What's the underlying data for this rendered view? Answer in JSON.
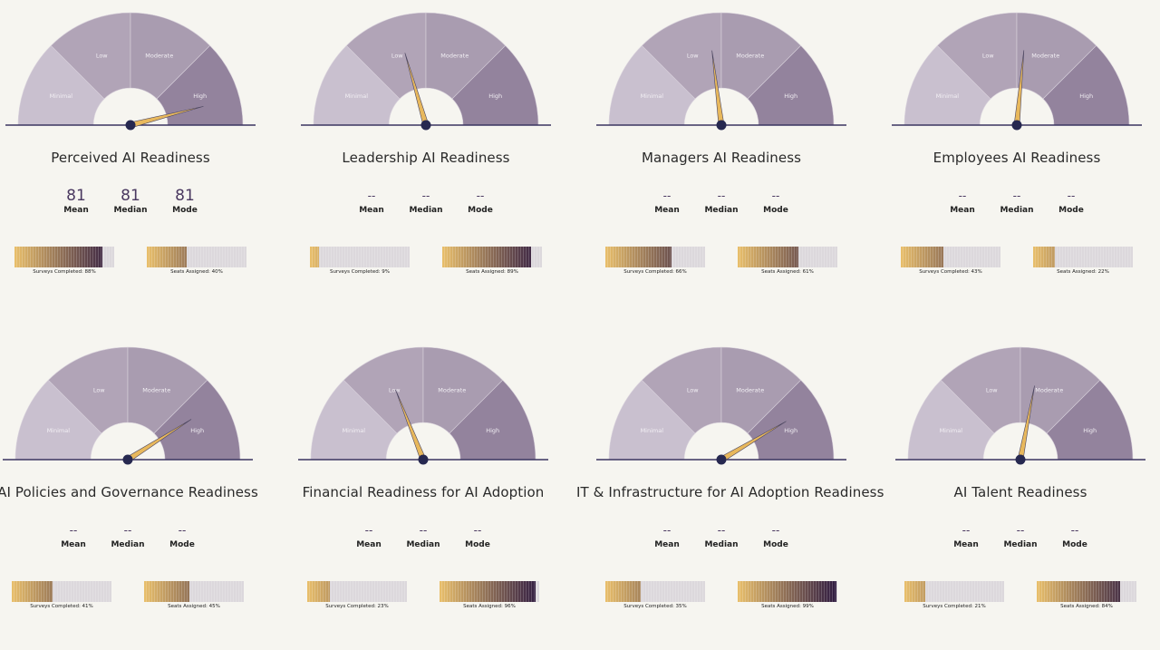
{
  "gauge_segments": [
    "Minimal",
    "Low",
    "Moderate",
    "High"
  ],
  "colors": {
    "background": "#f6f5f0",
    "segment_minimal": "#c9c0cf",
    "segment_low": "#b1a4b7",
    "segment_moderate": "#a99cb0",
    "segment_high": "#93839d",
    "needle": "#e8b85c",
    "hub": "#262850",
    "baseline": "#3a3560",
    "stat_value": "#4a3860",
    "bar_start": "#e9bf6b",
    "bar_end": "#2c1840",
    "bar_empty": "#dcd8dc"
  },
  "stat_labels": {
    "mean": "Mean",
    "median": "Median",
    "mode": "Mode"
  },
  "chart_data": [
    {
      "type": "gauge",
      "title": "Perceived AI Readiness",
      "needle_fraction": 0.92,
      "stats": {
        "mean": "81",
        "median": "81",
        "mode": "81"
      },
      "surveys_completed_pct": 88,
      "seats_assigned_pct": 40,
      "surveys_label": "Surveys Completed: 88%",
      "seats_label": "Seats Assigned: 40%"
    },
    {
      "type": "gauge",
      "title": "Leadership AI Readiness",
      "needle_fraction": 0.41,
      "stats": {
        "mean": "--",
        "median": "--",
        "mode": "--"
      },
      "surveys_completed_pct": 9,
      "seats_assigned_pct": 89,
      "surveys_label": "Surveys Completed: 9%",
      "seats_label": "Seats Assigned: 89%"
    },
    {
      "type": "gauge",
      "title": "Managers AI Readiness",
      "needle_fraction": 0.46,
      "stats": {
        "mean": "--",
        "median": "--",
        "mode": "--"
      },
      "surveys_completed_pct": 66,
      "seats_assigned_pct": 61,
      "surveys_label": "Surveys Completed: 66%",
      "seats_label": "Seats Assigned: 61%"
    },
    {
      "type": "gauge",
      "title": "Employees AI Readiness",
      "needle_fraction": 0.53,
      "stats": {
        "mean": "--",
        "median": "--",
        "mode": "--"
      },
      "surveys_completed_pct": 43,
      "seats_assigned_pct": 22,
      "surveys_label": "Surveys Completed: 43%",
      "seats_label": "Seats Assigned: 22%"
    },
    {
      "type": "gauge",
      "title": "AI Policies and Governance Readiness",
      "needle_fraction": 0.82,
      "stats": {
        "mean": "--",
        "median": "--",
        "mode": "--"
      },
      "surveys_completed_pct": 41,
      "seats_assigned_pct": 45,
      "surveys_label": "Surveys Completed: 41%",
      "seats_label": "Seats Assigned: 45%"
    },
    {
      "type": "gauge",
      "title": "Financial Readiness for AI Adoption",
      "needle_fraction": 0.38,
      "stats": {
        "mean": "--",
        "median": "--",
        "mode": "--"
      },
      "surveys_completed_pct": 23,
      "seats_assigned_pct": 96,
      "surveys_label": "Surveys Completed: 23%",
      "seats_label": "Seats Assigned: 96%"
    },
    {
      "type": "gauge",
      "title": "IT & Infrastructure for AI Adoption Readiness",
      "needle_fraction": 0.83,
      "stats": {
        "mean": "--",
        "median": "--",
        "mode": "--"
      },
      "surveys_completed_pct": 35,
      "seats_assigned_pct": 99,
      "surveys_label": "Surveys Completed: 35%",
      "seats_label": "Seats Assigned: 99%"
    },
    {
      "type": "gauge",
      "title": "AI Talent Readiness",
      "needle_fraction": 0.56,
      "stats": {
        "mean": "--",
        "median": "--",
        "mode": "--"
      },
      "surveys_completed_pct": 21,
      "seats_assigned_pct": 84,
      "surveys_label": "Surveys Completed: 21%",
      "seats_label": "Seats Assigned: 84%"
    }
  ]
}
